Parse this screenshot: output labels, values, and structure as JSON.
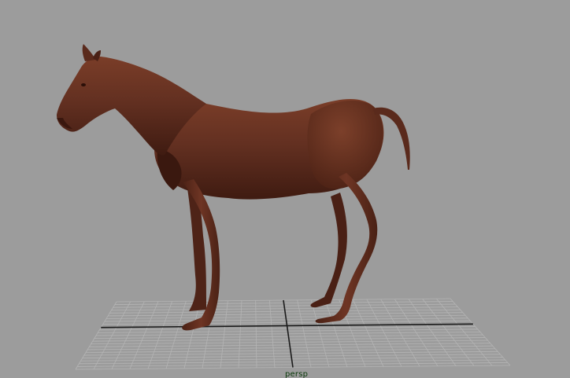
{
  "viewport": {
    "camera_name": "persp",
    "background_color": "#9c9c9c",
    "grid_color": "#b4b4b4",
    "axis_color": "#1a1a1a",
    "model_color": "#5a2a1c"
  },
  "scene": {
    "objects": [
      {
        "name": "horse-model",
        "icon": "horse-mesh"
      },
      {
        "name": "ground-grid",
        "icon": "grid-plane"
      }
    ]
  }
}
